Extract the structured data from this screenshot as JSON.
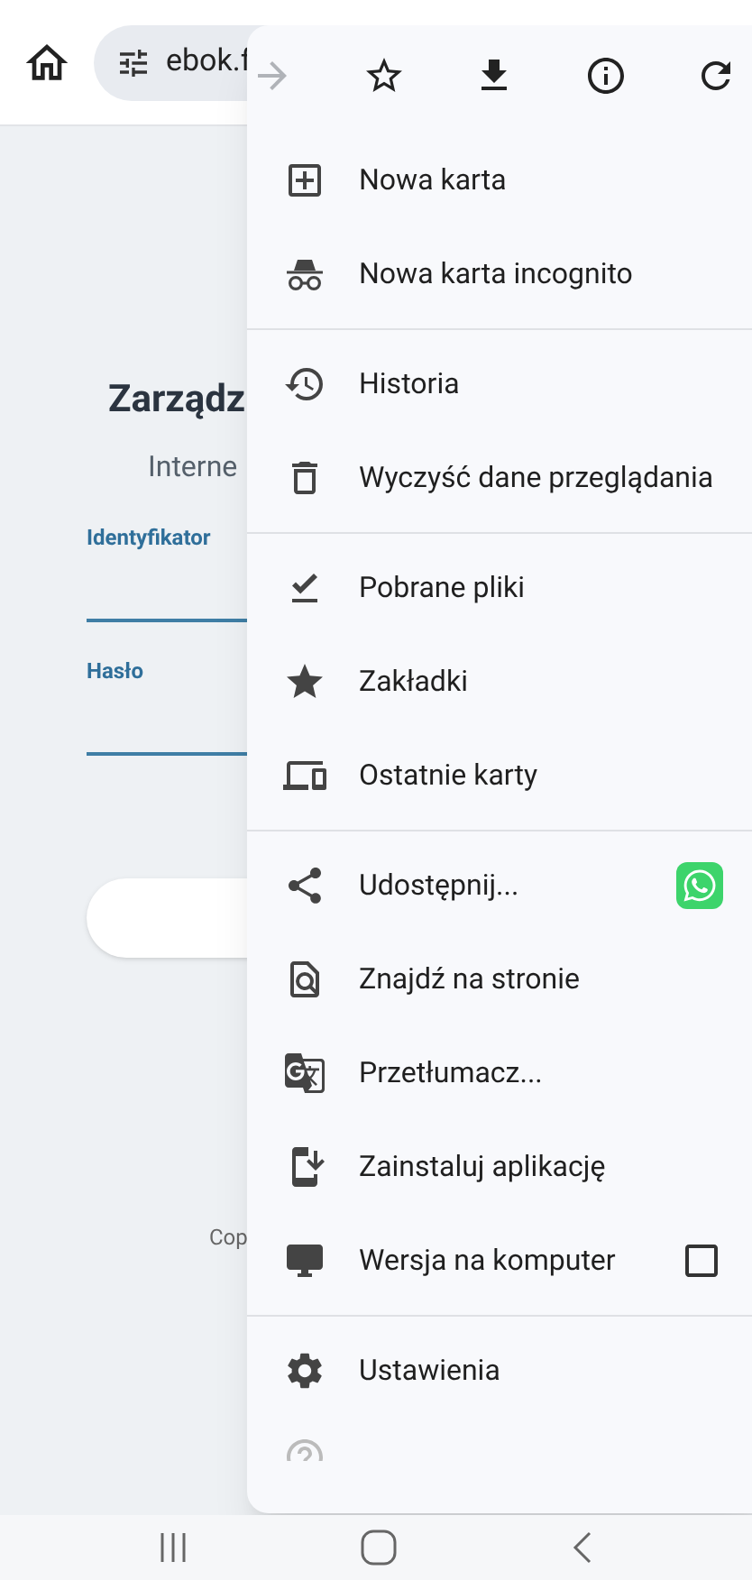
{
  "address_bar": {
    "url": "ebok.f"
  },
  "page": {
    "title": "Zarządz",
    "subtitle": "Interne",
    "fields": [
      {
        "label": "Identyfikator"
      },
      {
        "label": "Hasło"
      }
    ],
    "footer": "Cop"
  },
  "menu": {
    "toolbar": [
      {
        "kind": "forward",
        "disabled": true
      },
      {
        "kind": "bookmark",
        "disabled": false
      },
      {
        "kind": "download",
        "disabled": false
      },
      {
        "kind": "info",
        "disabled": false
      },
      {
        "kind": "reload",
        "disabled": false
      }
    ],
    "sections": [
      [
        {
          "kind": "plain",
          "label": "Nowa karta"
        },
        {
          "kind": "plain",
          "label": "Nowa karta incognito"
        }
      ],
      [
        {
          "kind": "plain",
          "label": "Historia"
        },
        {
          "kind": "plain",
          "label": "Wyczyść dane przeglądania"
        }
      ],
      [
        {
          "kind": "plain",
          "label": "Pobrane pliki"
        },
        {
          "kind": "plain",
          "label": "Zakładki"
        },
        {
          "kind": "plain",
          "label": "Ostatnie karty"
        }
      ],
      [
        {
          "kind": "share",
          "label": "Udostępnij..."
        },
        {
          "kind": "plain",
          "label": "Znajdź na stronie"
        },
        {
          "kind": "plain",
          "label": "Przetłumacz..."
        },
        {
          "kind": "plain",
          "label": "Zainstaluj aplikację"
        },
        {
          "kind": "checkbox",
          "label": "Wersja na komputer",
          "checked": false
        }
      ],
      [
        {
          "kind": "plain",
          "label": "Ustawienia"
        },
        {
          "kind": "cut"
        }
      ]
    ]
  }
}
